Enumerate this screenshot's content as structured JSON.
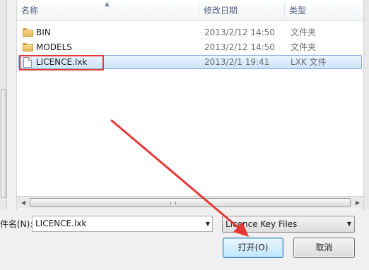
{
  "columns": {
    "name": "名称",
    "date": "修改日期",
    "type": "类型"
  },
  "files": [
    {
      "name": "BIN",
      "date": "2013/2/12 14:50",
      "type": "文件夹",
      "icon": "folder-icon",
      "selected": false
    },
    {
      "name": "MODELS",
      "date": "2013/2/12 14:50",
      "type": "文件夹",
      "icon": "folder-icon",
      "selected": false
    },
    {
      "name": "LICENCE.lxk",
      "date": "2013/2/1 19:41",
      "type": "LXK 文件",
      "icon": "file-icon",
      "selected": true
    }
  ],
  "filename": {
    "label": "件名(N):",
    "value": "LICENCE.lxk"
  },
  "filter": {
    "selected": "Licence Key Files"
  },
  "buttons": {
    "open": "打开(O)",
    "cancel": "取消"
  },
  "annotation_color": "#e53935",
  "accent_selection": "#cce4fa"
}
